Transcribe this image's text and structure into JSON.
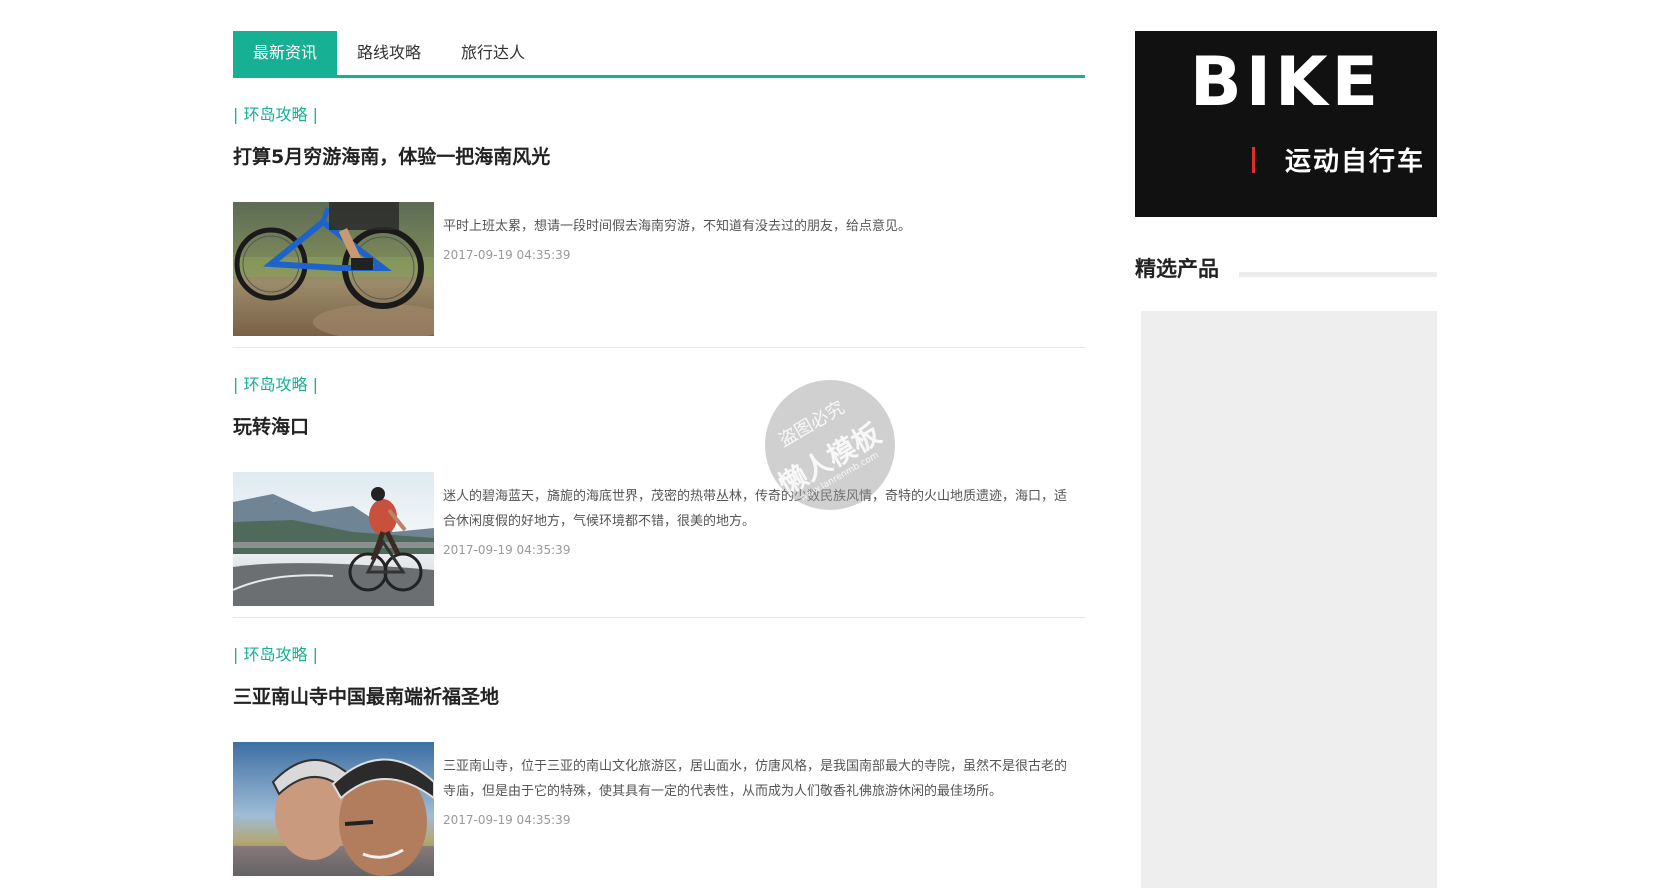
{
  "tabs": [
    {
      "label": "最新资讯",
      "active": true
    },
    {
      "label": "路线攻略",
      "active": false
    },
    {
      "label": "旅行达人",
      "active": false
    }
  ],
  "articles": [
    {
      "category": "| 环岛攻略 |",
      "title": "打算5月穷游海南，体验一把海南风光",
      "description": "平时上班太累，想请一段时间假去海南穷游，不知道有没去过的朋友，给点意见。",
      "date": "2017-09-19 04:35:39",
      "image": "bike-wheel-dirt-road"
    },
    {
      "category": "| 环岛攻略 |",
      "title": "玩转海口",
      "description": "迷人的碧海蓝天，旖旎的海底世界，茂密的热带丛林，传奇的少数民族风情，奇特的火山地质遗迹，海口，适合休闲度假的好地方，气候环境都不错，很美的地方。",
      "date": "2017-09-19 04:35:39",
      "image": "cyclist-mountain-road"
    },
    {
      "category": "| 环岛攻略 |",
      "title": "三亚南山寺中国最南端祈福圣地",
      "description": "三亚南山寺，位于三亚的南山文化旅游区，居山面水，仿唐风格，是我国南部最大的寺院，虽然不是很古老的寺庙，但是由于它的特殊，使其具有一定的代表性，从而成为人们敬香礼佛旅游休闲的最佳场所。",
      "date": "2017-09-19 04:35:39",
      "image": "cyclists-helmets"
    }
  ],
  "sidebar": {
    "banner_title": "BIKE",
    "banner_subtitle": "运动自行车",
    "section_title": "精选产品"
  },
  "watermark": {
    "line1": "盗图必究",
    "line2": "懒人模板",
    "line3": "www.lanrenmb.com"
  },
  "colors": {
    "accent": "#16b195",
    "banner_bg": "#111111",
    "banner_bar": "#d9302f",
    "placeholder": "#eeeeee"
  }
}
